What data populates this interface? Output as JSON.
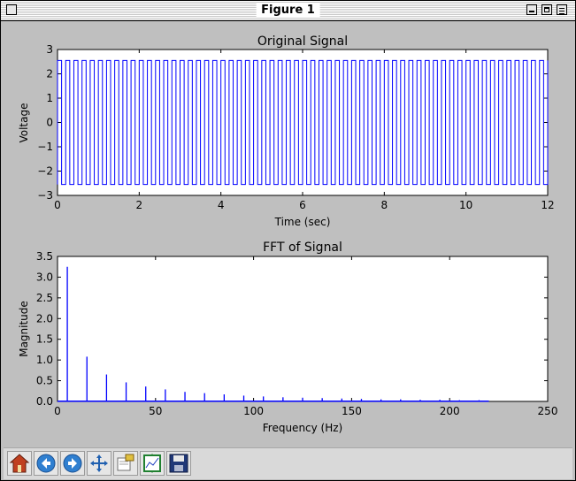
{
  "window": {
    "title": "Figure 1"
  },
  "colors": {
    "series": "#0000ff",
    "background": "#bfbfbf"
  },
  "chart_data": [
    {
      "type": "line",
      "title": "Original Signal",
      "xlabel": "Time (sec)",
      "ylabel": "Voltage",
      "xlim": [
        0,
        12
      ],
      "ylim": [
        -3,
        3
      ],
      "xticks": [
        "0",
        "2",
        "4",
        "6",
        "8",
        "10",
        "12"
      ],
      "yticks": [
        "3",
        "2",
        "1",
        "0",
        "−1",
        "−2",
        "−3"
      ],
      "series": [
        {
          "description": "square wave, ±2.55 V, frequency 5 Hz, time 0–12 s",
          "amplitude": 2.55,
          "frequency_hz": 5
        }
      ]
    },
    {
      "type": "line",
      "title": "FFT of Signal",
      "xlabel": "Frequency (Hz)",
      "ylabel": "Magnitude",
      "xlim": [
        0,
        250
      ],
      "ylim": [
        0,
        3.5
      ],
      "xticks": [
        "0",
        "50",
        "100",
        "150",
        "200",
        "250"
      ],
      "yticks": [
        "3.5",
        "3.0",
        "2.5",
        "2.0",
        "1.5",
        "1.0",
        "0.5",
        "0.0"
      ],
      "peaks": [
        {
          "x": 5,
          "y": 3.25
        },
        {
          "x": 15,
          "y": 1.08
        },
        {
          "x": 25,
          "y": 0.65
        },
        {
          "x": 35,
          "y": 0.46
        },
        {
          "x": 45,
          "y": 0.36
        },
        {
          "x": 55,
          "y": 0.29
        },
        {
          "x": 65,
          "y": 0.23
        },
        {
          "x": 75,
          "y": 0.2
        },
        {
          "x": 85,
          "y": 0.17
        },
        {
          "x": 95,
          "y": 0.14
        },
        {
          "x": 105,
          "y": 0.12
        },
        {
          "x": 115,
          "y": 0.1
        },
        {
          "x": 125,
          "y": 0.09
        },
        {
          "x": 135,
          "y": 0.08
        },
        {
          "x": 145,
          "y": 0.07
        },
        {
          "x": 155,
          "y": 0.06
        },
        {
          "x": 165,
          "y": 0.05
        },
        {
          "x": 175,
          "y": 0.05
        },
        {
          "x": 185,
          "y": 0.04
        },
        {
          "x": 195,
          "y": 0.04
        },
        {
          "x": 205,
          "y": 0.03
        },
        {
          "x": 215,
          "y": 0.03
        }
      ],
      "x_max_data": 220
    }
  ],
  "toolbar": [
    {
      "name": "home-button",
      "icon": "home-icon"
    },
    {
      "name": "back-button",
      "icon": "back-arrow-icon"
    },
    {
      "name": "forward-button",
      "icon": "forward-arrow-icon"
    },
    {
      "name": "pan-button",
      "icon": "move-icon"
    },
    {
      "name": "zoom-button",
      "icon": "zoom-rect-icon"
    },
    {
      "name": "subplots-button",
      "icon": "subplots-icon"
    },
    {
      "name": "save-button",
      "icon": "save-icon"
    }
  ]
}
